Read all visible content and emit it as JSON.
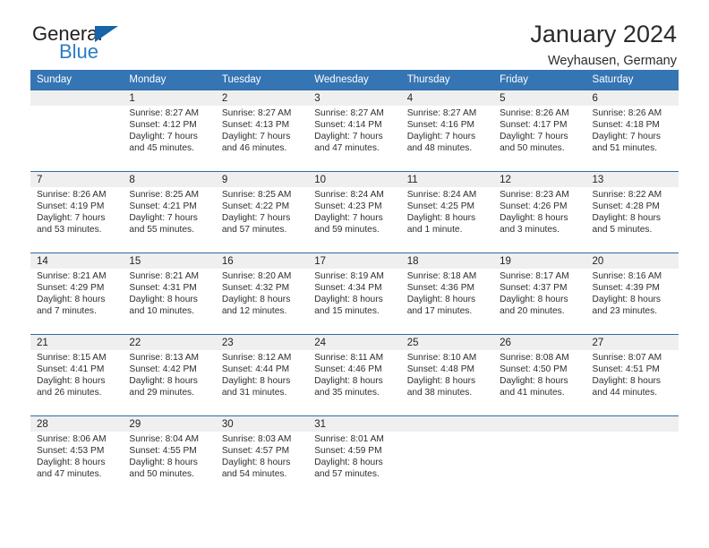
{
  "brand": {
    "name_part1": "General",
    "name_part2": "Blue",
    "logo_icon": "triangle-icon",
    "colors": {
      "black": "#231f20",
      "blue": "#2b7cc4",
      "triangle": "#1565a8",
      "header_band": "#3575b4",
      "row_divider": "#2e6da4",
      "daynum_band": "#efefef"
    }
  },
  "header": {
    "title": "January 2024",
    "subtitle": "Weyhausen, Germany"
  },
  "weekday_headers": [
    "Sunday",
    "Monday",
    "Tuesday",
    "Wednesday",
    "Thursday",
    "Friday",
    "Saturday"
  ],
  "weeks": [
    [
      {
        "day": "",
        "empty": true,
        "sunrise": "",
        "sunset": "",
        "daylight1": "",
        "daylight2": ""
      },
      {
        "day": "1",
        "empty": false,
        "sunrise": "Sunrise: 8:27 AM",
        "sunset": "Sunset: 4:12 PM",
        "daylight1": "Daylight: 7 hours",
        "daylight2": "and 45 minutes."
      },
      {
        "day": "2",
        "empty": false,
        "sunrise": "Sunrise: 8:27 AM",
        "sunset": "Sunset: 4:13 PM",
        "daylight1": "Daylight: 7 hours",
        "daylight2": "and 46 minutes."
      },
      {
        "day": "3",
        "empty": false,
        "sunrise": "Sunrise: 8:27 AM",
        "sunset": "Sunset: 4:14 PM",
        "daylight1": "Daylight: 7 hours",
        "daylight2": "and 47 minutes."
      },
      {
        "day": "4",
        "empty": false,
        "sunrise": "Sunrise: 8:27 AM",
        "sunset": "Sunset: 4:16 PM",
        "daylight1": "Daylight: 7 hours",
        "daylight2": "and 48 minutes."
      },
      {
        "day": "5",
        "empty": false,
        "sunrise": "Sunrise: 8:26 AM",
        "sunset": "Sunset: 4:17 PM",
        "daylight1": "Daylight: 7 hours",
        "daylight2": "and 50 minutes."
      },
      {
        "day": "6",
        "empty": false,
        "sunrise": "Sunrise: 8:26 AM",
        "sunset": "Sunset: 4:18 PM",
        "daylight1": "Daylight: 7 hours",
        "daylight2": "and 51 minutes."
      }
    ],
    [
      {
        "day": "7",
        "empty": false,
        "sunrise": "Sunrise: 8:26 AM",
        "sunset": "Sunset: 4:19 PM",
        "daylight1": "Daylight: 7 hours",
        "daylight2": "and 53 minutes."
      },
      {
        "day": "8",
        "empty": false,
        "sunrise": "Sunrise: 8:25 AM",
        "sunset": "Sunset: 4:21 PM",
        "daylight1": "Daylight: 7 hours",
        "daylight2": "and 55 minutes."
      },
      {
        "day": "9",
        "empty": false,
        "sunrise": "Sunrise: 8:25 AM",
        "sunset": "Sunset: 4:22 PM",
        "daylight1": "Daylight: 7 hours",
        "daylight2": "and 57 minutes."
      },
      {
        "day": "10",
        "empty": false,
        "sunrise": "Sunrise: 8:24 AM",
        "sunset": "Sunset: 4:23 PM",
        "daylight1": "Daylight: 7 hours",
        "daylight2": "and 59 minutes."
      },
      {
        "day": "11",
        "empty": false,
        "sunrise": "Sunrise: 8:24 AM",
        "sunset": "Sunset: 4:25 PM",
        "daylight1": "Daylight: 8 hours",
        "daylight2": "and 1 minute."
      },
      {
        "day": "12",
        "empty": false,
        "sunrise": "Sunrise: 8:23 AM",
        "sunset": "Sunset: 4:26 PM",
        "daylight1": "Daylight: 8 hours",
        "daylight2": "and 3 minutes."
      },
      {
        "day": "13",
        "empty": false,
        "sunrise": "Sunrise: 8:22 AM",
        "sunset": "Sunset: 4:28 PM",
        "daylight1": "Daylight: 8 hours",
        "daylight2": "and 5 minutes."
      }
    ],
    [
      {
        "day": "14",
        "empty": false,
        "sunrise": "Sunrise: 8:21 AM",
        "sunset": "Sunset: 4:29 PM",
        "daylight1": "Daylight: 8 hours",
        "daylight2": "and 7 minutes."
      },
      {
        "day": "15",
        "empty": false,
        "sunrise": "Sunrise: 8:21 AM",
        "sunset": "Sunset: 4:31 PM",
        "daylight1": "Daylight: 8 hours",
        "daylight2": "and 10 minutes."
      },
      {
        "day": "16",
        "empty": false,
        "sunrise": "Sunrise: 8:20 AM",
        "sunset": "Sunset: 4:32 PM",
        "daylight1": "Daylight: 8 hours",
        "daylight2": "and 12 minutes."
      },
      {
        "day": "17",
        "empty": false,
        "sunrise": "Sunrise: 8:19 AM",
        "sunset": "Sunset: 4:34 PM",
        "daylight1": "Daylight: 8 hours",
        "daylight2": "and 15 minutes."
      },
      {
        "day": "18",
        "empty": false,
        "sunrise": "Sunrise: 8:18 AM",
        "sunset": "Sunset: 4:36 PM",
        "daylight1": "Daylight: 8 hours",
        "daylight2": "and 17 minutes."
      },
      {
        "day": "19",
        "empty": false,
        "sunrise": "Sunrise: 8:17 AM",
        "sunset": "Sunset: 4:37 PM",
        "daylight1": "Daylight: 8 hours",
        "daylight2": "and 20 minutes."
      },
      {
        "day": "20",
        "empty": false,
        "sunrise": "Sunrise: 8:16 AM",
        "sunset": "Sunset: 4:39 PM",
        "daylight1": "Daylight: 8 hours",
        "daylight2": "and 23 minutes."
      }
    ],
    [
      {
        "day": "21",
        "empty": false,
        "sunrise": "Sunrise: 8:15 AM",
        "sunset": "Sunset: 4:41 PM",
        "daylight1": "Daylight: 8 hours",
        "daylight2": "and 26 minutes."
      },
      {
        "day": "22",
        "empty": false,
        "sunrise": "Sunrise: 8:13 AM",
        "sunset": "Sunset: 4:42 PM",
        "daylight1": "Daylight: 8 hours",
        "daylight2": "and 29 minutes."
      },
      {
        "day": "23",
        "empty": false,
        "sunrise": "Sunrise: 8:12 AM",
        "sunset": "Sunset: 4:44 PM",
        "daylight1": "Daylight: 8 hours",
        "daylight2": "and 31 minutes."
      },
      {
        "day": "24",
        "empty": false,
        "sunrise": "Sunrise: 8:11 AM",
        "sunset": "Sunset: 4:46 PM",
        "daylight1": "Daylight: 8 hours",
        "daylight2": "and 35 minutes."
      },
      {
        "day": "25",
        "empty": false,
        "sunrise": "Sunrise: 8:10 AM",
        "sunset": "Sunset: 4:48 PM",
        "daylight1": "Daylight: 8 hours",
        "daylight2": "and 38 minutes."
      },
      {
        "day": "26",
        "empty": false,
        "sunrise": "Sunrise: 8:08 AM",
        "sunset": "Sunset: 4:50 PM",
        "daylight1": "Daylight: 8 hours",
        "daylight2": "and 41 minutes."
      },
      {
        "day": "27",
        "empty": false,
        "sunrise": "Sunrise: 8:07 AM",
        "sunset": "Sunset: 4:51 PM",
        "daylight1": "Daylight: 8 hours",
        "daylight2": "and 44 minutes."
      }
    ],
    [
      {
        "day": "28",
        "empty": false,
        "sunrise": "Sunrise: 8:06 AM",
        "sunset": "Sunset: 4:53 PM",
        "daylight1": "Daylight: 8 hours",
        "daylight2": "and 47 minutes."
      },
      {
        "day": "29",
        "empty": false,
        "sunrise": "Sunrise: 8:04 AM",
        "sunset": "Sunset: 4:55 PM",
        "daylight1": "Daylight: 8 hours",
        "daylight2": "and 50 minutes."
      },
      {
        "day": "30",
        "empty": false,
        "sunrise": "Sunrise: 8:03 AM",
        "sunset": "Sunset: 4:57 PM",
        "daylight1": "Daylight: 8 hours",
        "daylight2": "and 54 minutes."
      },
      {
        "day": "31",
        "empty": false,
        "sunrise": "Sunrise: 8:01 AM",
        "sunset": "Sunset: 4:59 PM",
        "daylight1": "Daylight: 8 hours",
        "daylight2": "and 57 minutes."
      },
      {
        "day": "",
        "empty": true,
        "sunrise": "",
        "sunset": "",
        "daylight1": "",
        "daylight2": ""
      },
      {
        "day": "",
        "empty": true,
        "sunrise": "",
        "sunset": "",
        "daylight1": "",
        "daylight2": ""
      },
      {
        "day": "",
        "empty": true,
        "sunrise": "",
        "sunset": "",
        "daylight1": "",
        "daylight2": ""
      }
    ]
  ]
}
